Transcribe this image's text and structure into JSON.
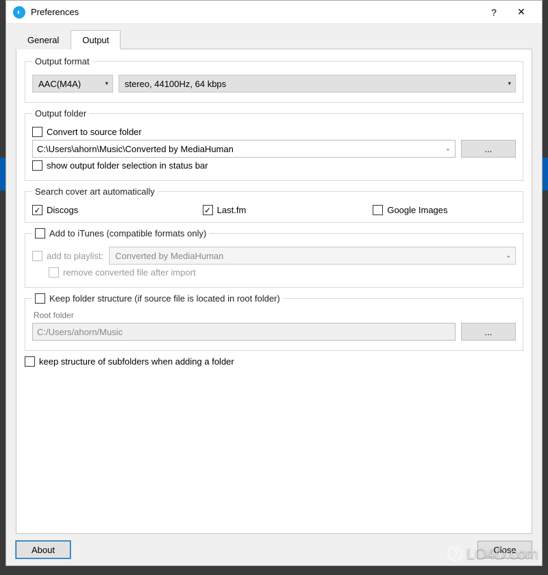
{
  "window": {
    "title": "Preferences",
    "help_tooltip": "?",
    "close_tooltip": "Close"
  },
  "tabs": {
    "general": "General",
    "output": "Output",
    "active": "output"
  },
  "output_format": {
    "legend": "Output format",
    "codec": "AAC(M4A)",
    "quality": "stereo, 44100Hz, 64 kbps"
  },
  "output_folder": {
    "legend": "Output folder",
    "convert_to_source": {
      "label": "Convert to source folder",
      "checked": false
    },
    "path": "C:\\Users\\ahorn\\Music\\Converted by MediaHuman",
    "browse": "...",
    "show_in_statusbar": {
      "label": "show output folder selection in status bar",
      "checked": false
    }
  },
  "cover_art": {
    "legend": "Search cover art automatically",
    "discogs": {
      "label": "Discogs",
      "checked": true
    },
    "lastfm": {
      "label": "Last.fm",
      "checked": true
    },
    "google": {
      "label": "Google Images",
      "checked": false
    }
  },
  "itunes": {
    "add_to_itunes": {
      "label": "Add to iTunes (compatible formats only)",
      "checked": false
    },
    "add_to_playlist": {
      "label": "add to playlist:",
      "checked": false,
      "enabled": false
    },
    "playlist_name": "Converted by MediaHuman",
    "remove_after_import": {
      "label": "remove converted file after import",
      "checked": false,
      "enabled": false
    }
  },
  "folder_structure": {
    "keep_structure": {
      "label": "Keep folder structure (if source file is located in root folder)",
      "checked": false
    },
    "root_folder_label": "Root folder",
    "root_folder": "C:/Users/ahorn/Music",
    "browse": "...",
    "keep_subfolders": {
      "label": "keep structure of subfolders when adding a folder",
      "checked": false
    }
  },
  "footer": {
    "about": "About",
    "close": "Close"
  },
  "watermark": "LO4D.com"
}
